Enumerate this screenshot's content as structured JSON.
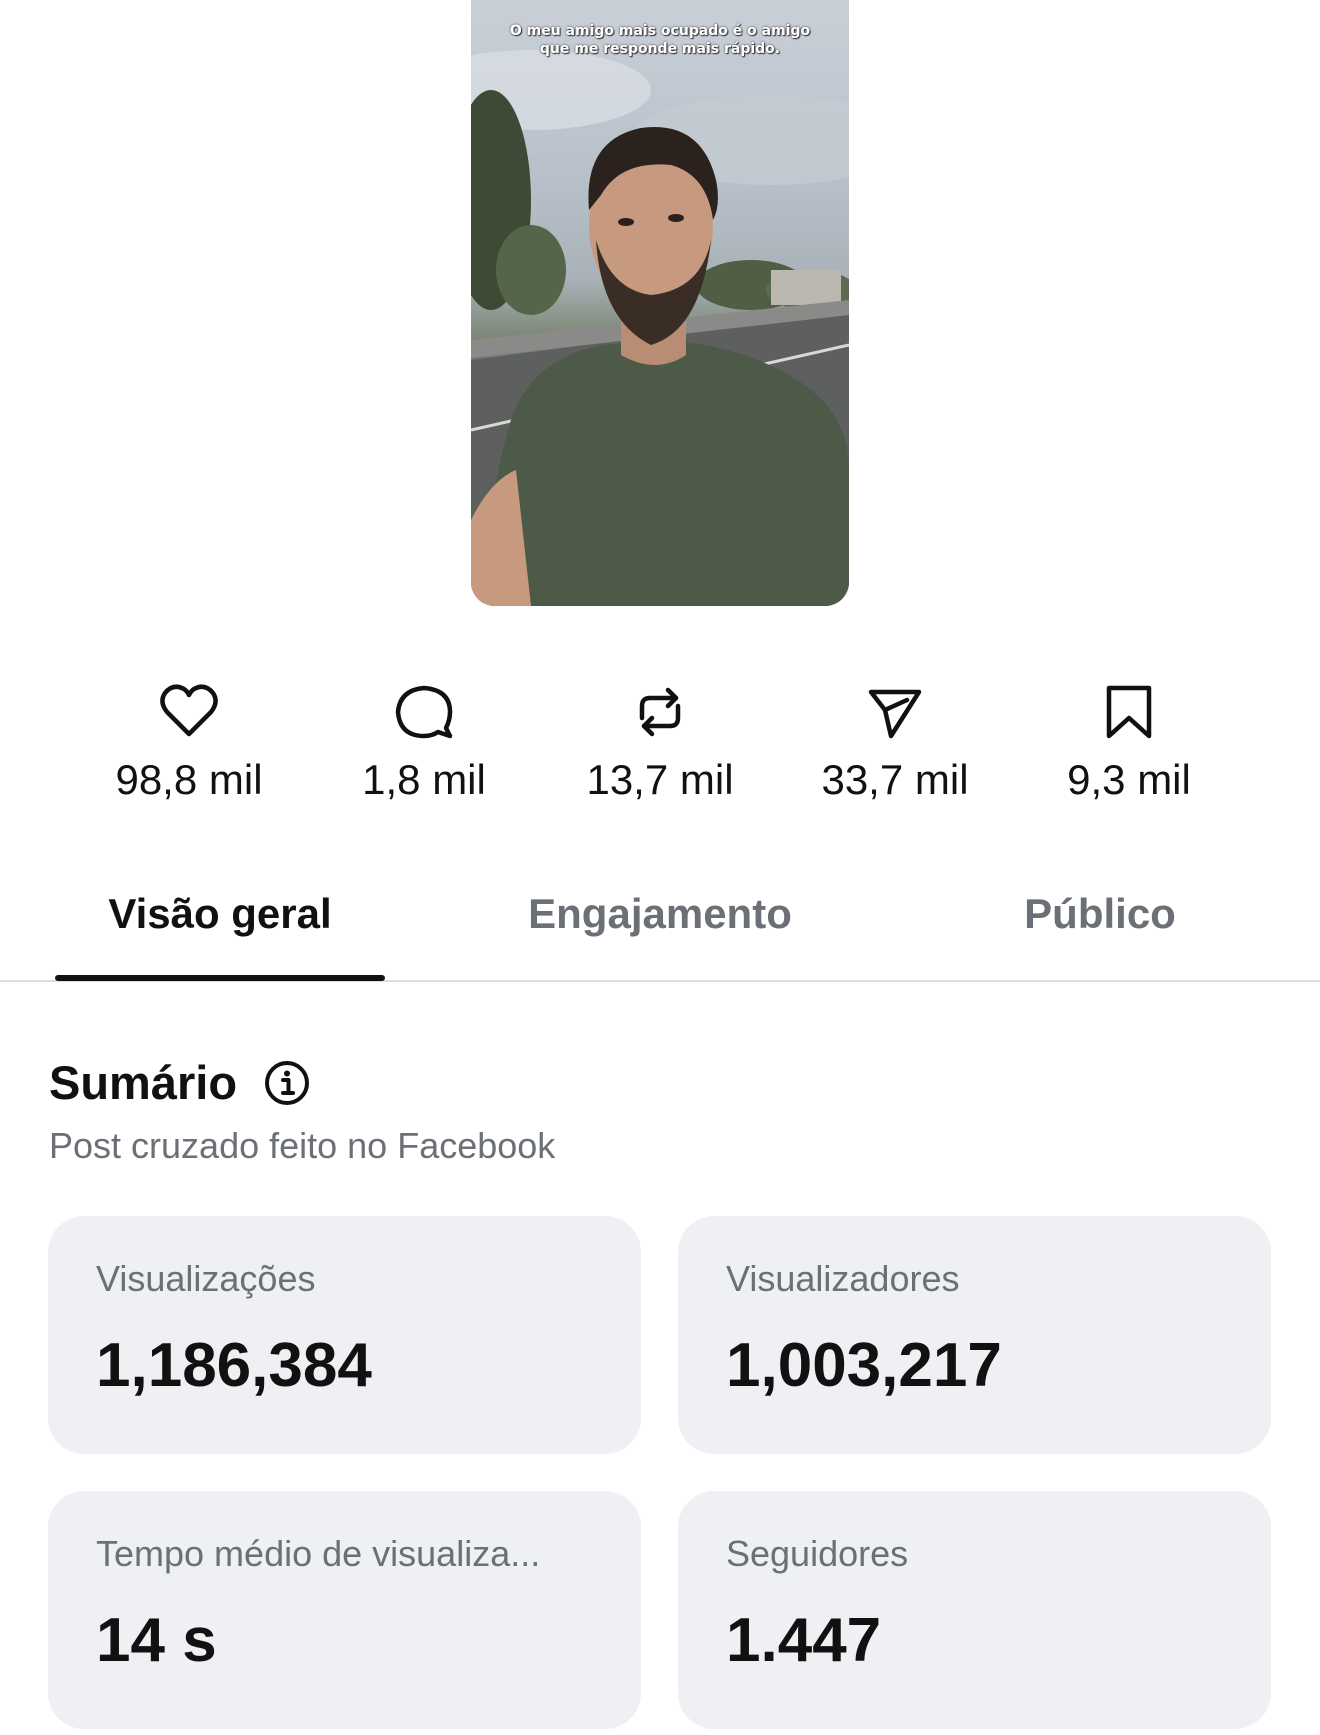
{
  "video": {
    "caption": "O meu amigo mais ocupado é o amigo que me responde mais rápido."
  },
  "stats": [
    {
      "icon": "heart-icon",
      "value": "98,8 mil"
    },
    {
      "icon": "comment-icon",
      "value": "1,8 mil"
    },
    {
      "icon": "repost-icon",
      "value": "13,7 mil"
    },
    {
      "icon": "share-icon",
      "value": "33,7 mil"
    },
    {
      "icon": "bookmark-icon",
      "value": "9,3 mil"
    }
  ],
  "tabs": [
    {
      "label": "Visão geral",
      "active": true
    },
    {
      "label": "Engajamento",
      "active": false
    },
    {
      "label": "Público",
      "active": false
    }
  ],
  "summary": {
    "title": "Sumário",
    "subtitle": "Post cruzado feito no Facebook"
  },
  "cards": [
    {
      "label": "Visualizações",
      "value": "1,186,384"
    },
    {
      "label": "Visualizadores",
      "value": "1,003,217"
    },
    {
      "label": "Tempo médio de visualiza...",
      "value": "14 s"
    },
    {
      "label": "Seguidores",
      "value": "1.447"
    }
  ]
}
